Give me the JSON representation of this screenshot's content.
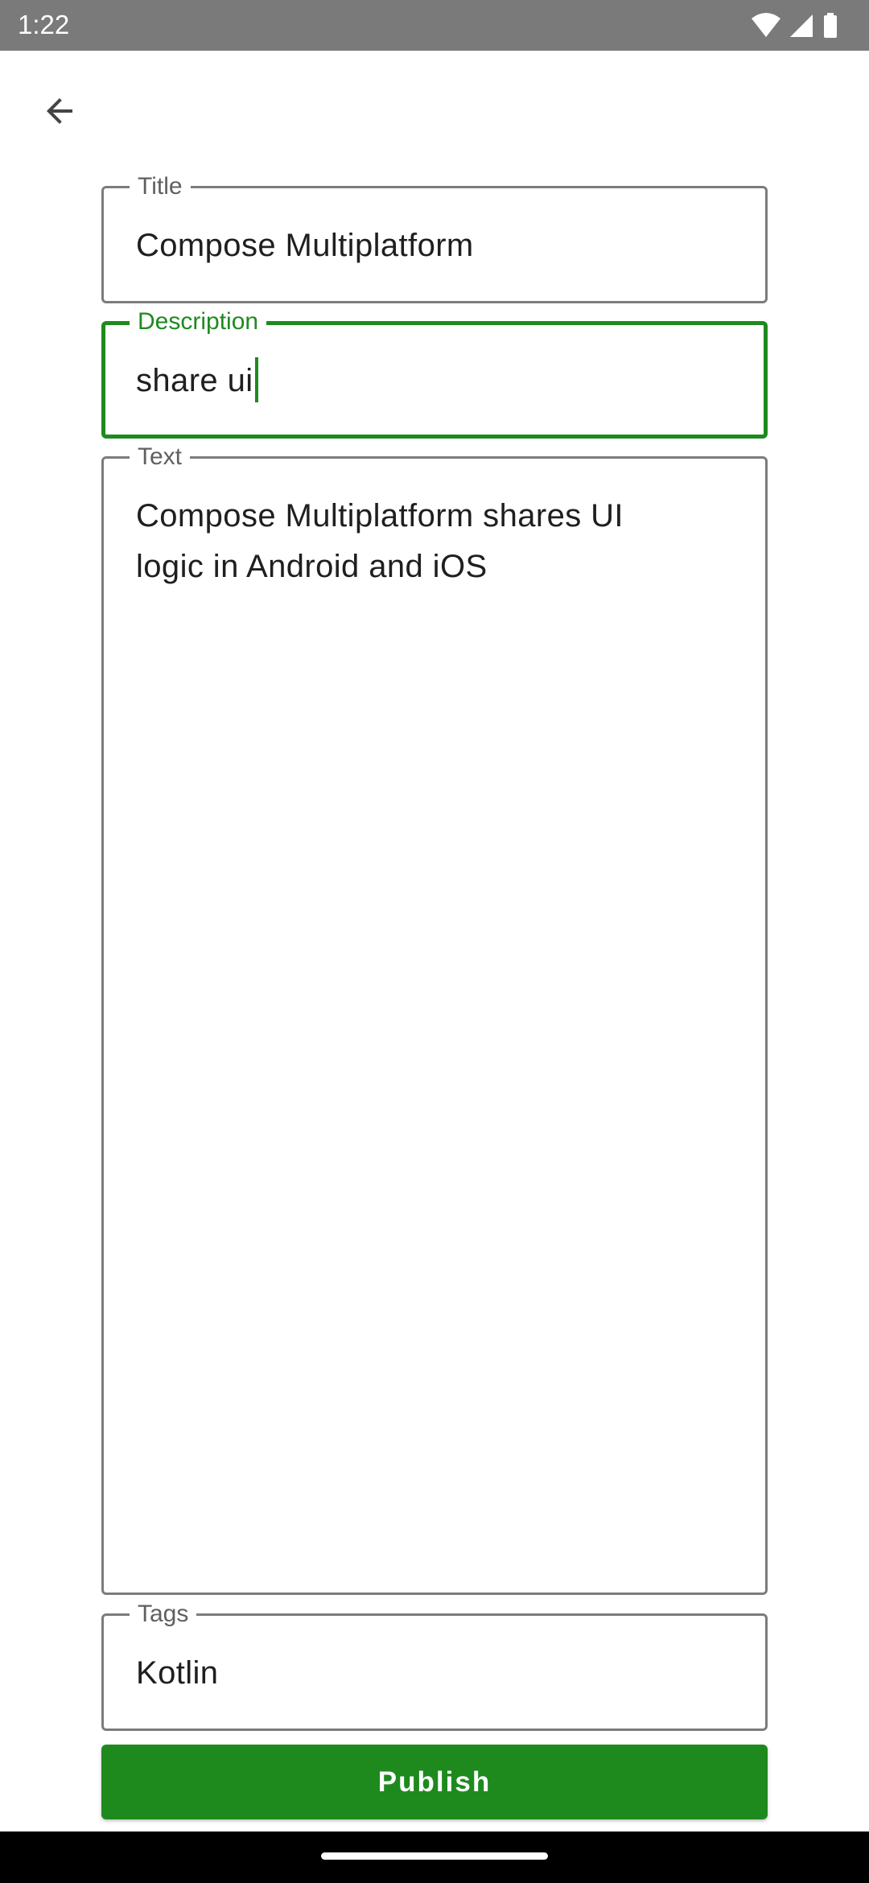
{
  "status_bar": {
    "time": "1:22",
    "icons": [
      "wifi-icon",
      "signal-icon",
      "battery-icon"
    ]
  },
  "toolbar": {
    "back_icon": "arrow-back-icon"
  },
  "form": {
    "title": {
      "label": "Title",
      "value": "Compose Multiplatform"
    },
    "description": {
      "label": "Description",
      "value": "share ui",
      "focused": true
    },
    "text": {
      "label": "Text",
      "value": "Compose Multiplatform shares UI\nlogic in Android and iOS"
    },
    "tags": {
      "label": "Tags",
      "value": "Kotlin"
    },
    "publish_label": "Publish"
  },
  "colors": {
    "accent": "#1E8A1E",
    "status_bar": "#7A7A7A",
    "outline": "#7C7C7C",
    "nav_bar": "#000000"
  }
}
